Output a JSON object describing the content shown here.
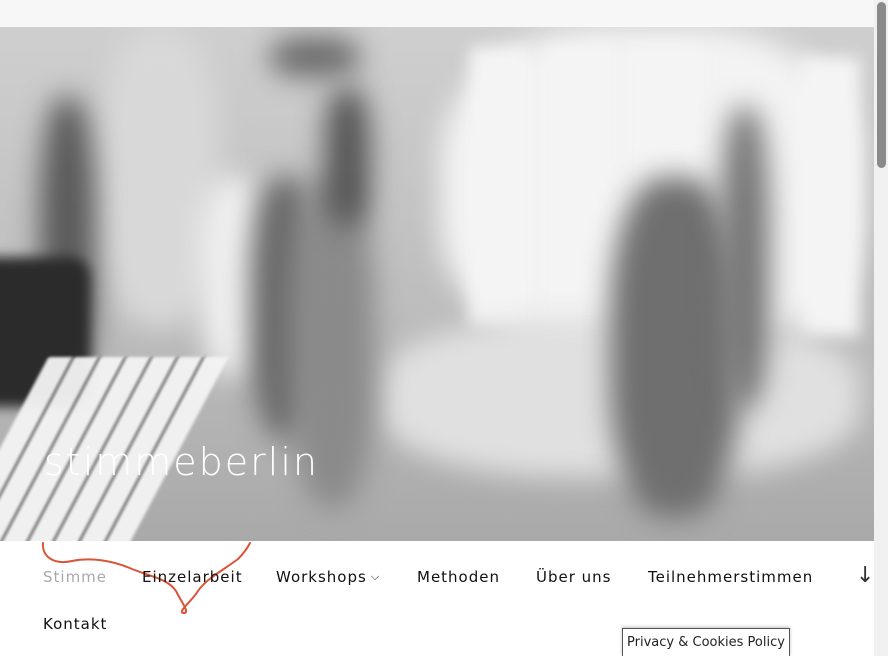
{
  "site": {
    "title": "stimmeberlin"
  },
  "nav": {
    "items": [
      {
        "label": "Stimme",
        "active": true
      },
      {
        "label": "Einzelarbeit"
      },
      {
        "label": "Workshops",
        "has_submenu": true
      },
      {
        "label": "Methoden"
      },
      {
        "label": "Über uns"
      },
      {
        "label": "Teilnehmerstimmen"
      },
      {
        "label": "Kontakt"
      }
    ],
    "menu_toggle_icon": "arrow-down-icon",
    "submenu_icon": "chevron-down-icon"
  },
  "hero": {
    "image": "blurred-rehearsal-room-photo"
  },
  "cookie": {
    "label": "Privacy & Cookies Policy"
  },
  "colors": {
    "accent_scribble": "#d9553a",
    "active_nav": "#a9a9a9",
    "nav_text": "#111111"
  }
}
